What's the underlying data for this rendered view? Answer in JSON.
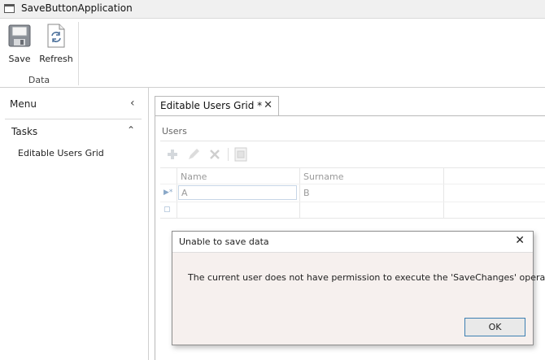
{
  "window": {
    "title": "SaveButtonApplication"
  },
  "ribbon": {
    "buttons": [
      {
        "label": "Save",
        "icon": "save-icon"
      },
      {
        "label": "Refresh",
        "icon": "refresh-icon"
      }
    ],
    "group_label": "Data"
  },
  "nav": {
    "header": "Menu",
    "collapse_glyph": "‹",
    "section": "Tasks",
    "section_glyph": "⌃",
    "items": [
      {
        "label": "Editable Users Grid"
      }
    ]
  },
  "tab": {
    "label": "Editable Users Grid *",
    "close_glyph": "✕"
  },
  "screen": {
    "group_label": "Users",
    "grid": {
      "columns": [
        "Name",
        "Surname"
      ],
      "rows": [
        {
          "name": "A",
          "surname": "B"
        }
      ]
    }
  },
  "dialog": {
    "title": "Unable to save data",
    "close_glyph": "✕",
    "message": "The current user does not have permission to execute the 'SaveChanges' operation.",
    "ok_label": "OK"
  },
  "colors": {
    "accent": "#3c7fb1",
    "dialog_bg": "#f6f0ee"
  }
}
